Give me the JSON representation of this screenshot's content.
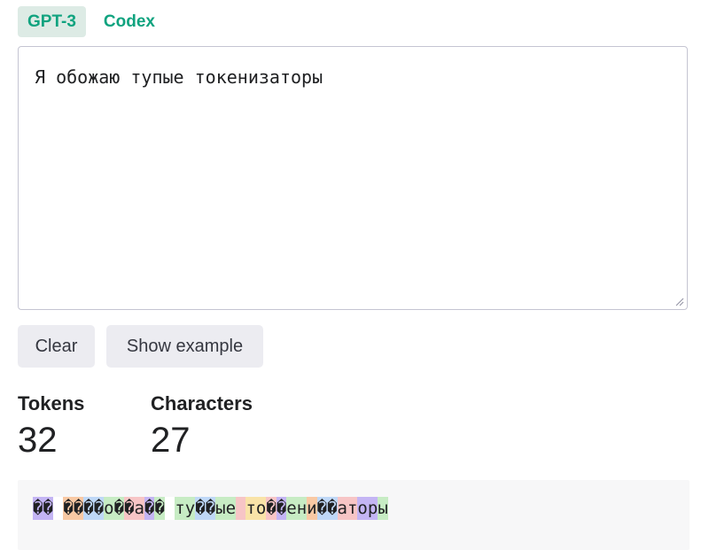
{
  "tabs": [
    {
      "label": "GPT-3",
      "active": true
    },
    {
      "label": "Codex",
      "active": false
    }
  ],
  "editor": {
    "value": "Я обожаю тупые токенизаторы"
  },
  "buttons": {
    "clear": "Clear",
    "show_example": "Show example"
  },
  "stats": {
    "tokens_label": "Tokens",
    "tokens_value": "32",
    "characters_label": "Characters",
    "characters_value": "27"
  },
  "token_output": {
    "tokens": [
      {
        "text": "�",
        "color": "#c4b5f4"
      },
      {
        "text": "�",
        "color": "#c4b5f4"
      },
      {
        "text": " ",
        "color": "#ffffff"
      },
      {
        "text": "�",
        "color": "#f9c9a4"
      },
      {
        "text": "�",
        "color": "#f9c9a4"
      },
      {
        "text": "�",
        "color": "#bfd8f7"
      },
      {
        "text": "�",
        "color": "#bfd8f7"
      },
      {
        "text": "о",
        "color": "#c7ecc4"
      },
      {
        "text": "�",
        "color": "#c7ecc4"
      },
      {
        "text": "�",
        "color": "#f7c5c6"
      },
      {
        "text": "а",
        "color": "#f7c5c6"
      },
      {
        "text": "�",
        "color": "#c4b5f4"
      },
      {
        "text": "�",
        "color": "#c7ecc4"
      },
      {
        "text": " ",
        "color": "#ffffff"
      },
      {
        "text": "ту",
        "color": "#c7ecc4"
      },
      {
        "text": "�",
        "color": "#bfd8f7"
      },
      {
        "text": "�",
        "color": "#bfd8f7"
      },
      {
        "text": "ые",
        "color": "#c7ecc4"
      },
      {
        "text": " ",
        "color": "#f7c5c6"
      },
      {
        "text": "то",
        "color": "#f9e3a8"
      },
      {
        "text": "�",
        "color": "#f7c5c6"
      },
      {
        "text": "�",
        "color": "#c4b5f4"
      },
      {
        "text": "ен",
        "color": "#c7ecc4"
      },
      {
        "text": "и",
        "color": "#f9c9a4"
      },
      {
        "text": "�",
        "color": "#bfd8f7"
      },
      {
        "text": "�",
        "color": "#bfd8f7"
      },
      {
        "text": "ат",
        "color": "#f7c5c6"
      },
      {
        "text": "ор",
        "color": "#c4b5f4"
      },
      {
        "text": "ы",
        "color": "#c7ecc4"
      }
    ]
  },
  "colors": {
    "accent": "#10a37f",
    "tab_active_bg": "#ddebe5",
    "button_bg": "#ececf1",
    "output_bg": "#f7f7f8"
  }
}
